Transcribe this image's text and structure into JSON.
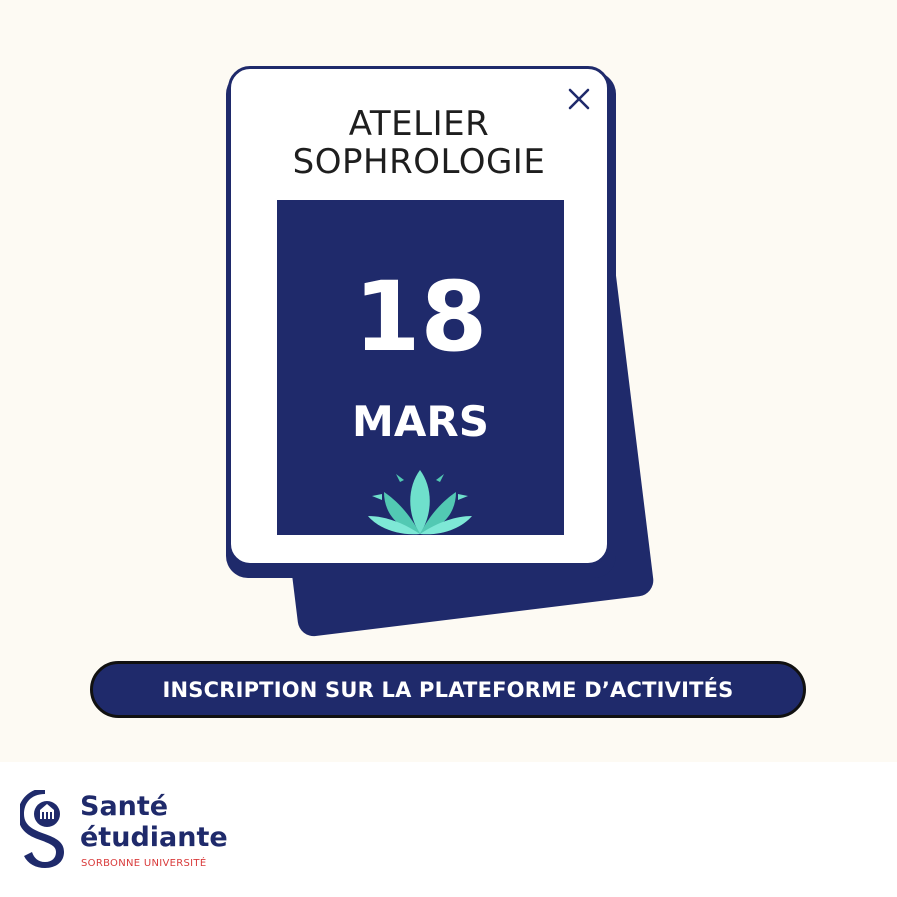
{
  "event": {
    "title_line1": "ATELIER",
    "title_line2": "SOPHROLOGIE",
    "day": "18",
    "month": "MARS"
  },
  "cta": {
    "label": "INSCRIPTION SUR LA PLATEFORME D’ACTIVITÉS"
  },
  "logo": {
    "word1": "Santé",
    "word2": "étudiante",
    "subtitle": "SORBONNE UNIVERSITÉ"
  },
  "icons": {
    "close": "close-icon",
    "lotus": "lotus-icon",
    "logo_mark": "sante-etudiante-logo-mark"
  },
  "colors": {
    "navy": "#1f2a6b",
    "cream_background": "#fdfaf3",
    "lotus_teal": "#5fd0bf",
    "logo_red": "#d93a3a"
  }
}
